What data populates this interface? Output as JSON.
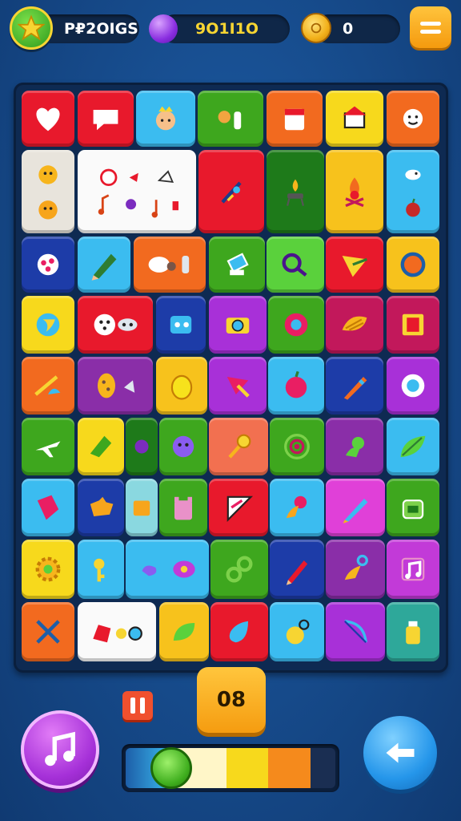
{
  "hud": {
    "player_label": "P₽2OIGS",
    "gems_value": "9O1I1O",
    "coins_value": "0"
  },
  "bottom": {
    "moves_counter": "08",
    "progress_fraction": 0.2
  },
  "colors": {
    "background": "#164a8a",
    "board": "#0e2a52",
    "accent_orange": "#f59c10",
    "accent_purple": "#a530d8",
    "accent_blue": "#2596ea"
  },
  "tiles_icons": [
    "heart-icon",
    "speech-bubble-icon",
    "princess-face-icon",
    "figures-icon",
    "calendar-icon",
    "house-icon",
    "sun-face-icon",
    "smiley-faces-icon",
    "music-notes-card-icon",
    "tools-icon",
    "drop-table-icon",
    "campfire-icon",
    "fish-apple-icon",
    "ball-icon",
    "pencil-icon",
    "sweets-icon",
    "stamp-icon",
    "wrench-icon",
    "paper-plane-icon",
    "ring-icon",
    "globe-icon",
    "dice-icon",
    "robot-face-icon",
    "camera-icon",
    "donut-icon",
    "shell-icon",
    "film-icon",
    "pipe-icon",
    "cookie-icon",
    "lemon-icon",
    "arrow-icon",
    "berry-icon",
    "pen-icon",
    "eye-icon",
    "airplane-icon",
    "shuttlecock-icon",
    "grape-icon",
    "hammer-icon",
    "target-icon",
    "bird-icon",
    "leaf-icon",
    "gem-icon",
    "puzzle-icon",
    "castle-icon",
    "pizza-icon",
    "flower-icon",
    "crayon-icon",
    "bucket-icon",
    "gear-icon",
    "key-icon",
    "bean-icon",
    "glasses-icon",
    "marker-icon",
    "rattle-icon",
    "music-note-icon",
    "scissors-icon",
    "toy-car-icon",
    "sprout-icon",
    "drop-icon",
    "hen-icon",
    "bow-icon",
    "bottle-icon"
  ]
}
